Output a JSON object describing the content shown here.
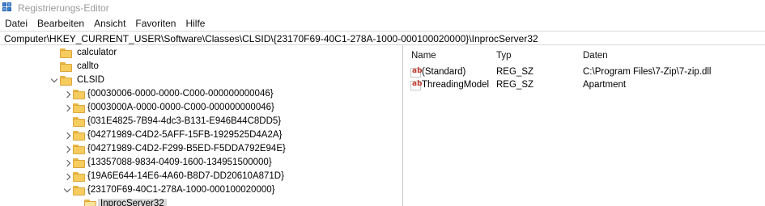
{
  "window": {
    "title": "Registrierungs-Editor",
    "app_icon": "regedit-icon"
  },
  "menu": [
    "Datei",
    "Bearbeiten",
    "Ansicht",
    "Favoriten",
    "Hilfe"
  ],
  "address": "Computer\\HKEY_CURRENT_USER\\Software\\Classes\\CLSID\\{23170F69-40C1-278A-1000-000100020000}\\InprocServer32",
  "tree": [
    {
      "label": "calculator",
      "chevron": "none",
      "open": false,
      "selected": false
    },
    {
      "label": "callto",
      "chevron": "none",
      "open": false,
      "selected": false
    },
    {
      "label": "CLSID",
      "chevron": "down",
      "open": false,
      "selected": false
    },
    {
      "label": "{00030006-0000-0000-C000-000000000046}",
      "chevron": "right",
      "open": false,
      "selected": false
    },
    {
      "label": "{0003000A-0000-0000-C000-000000000046}",
      "chevron": "right",
      "open": false,
      "selected": false
    },
    {
      "label": "{031E4825-7B94-4dc3-B131-E946B44C8DD5}",
      "chevron": "none",
      "open": false,
      "selected": false
    },
    {
      "label": "{04271989-C4D2-5AFF-15FB-1929525D4A2A}",
      "chevron": "right",
      "open": false,
      "selected": false
    },
    {
      "label": "{04271989-C4D2-F299-B5ED-F5DDA792E94E}",
      "chevron": "right",
      "open": false,
      "selected": false
    },
    {
      "label": "{13357088-9834-0409-1600-134951500000}",
      "chevron": "right",
      "open": false,
      "selected": false
    },
    {
      "label": "{19A6E644-14E6-4A60-B8D7-DD20610A871D}",
      "chevron": "right",
      "open": false,
      "selected": false
    },
    {
      "label": "{23170F69-40C1-278A-1000-000100020000}",
      "chevron": "down",
      "open": false,
      "selected": false
    },
    {
      "label": "InprocServer32",
      "chevron": "none",
      "open": true,
      "selected": true
    }
  ],
  "columns": {
    "name": "Name",
    "type": "Typ",
    "data": "Daten"
  },
  "values": [
    {
      "name": "(Standard)",
      "type": "REG_SZ",
      "data": "C:\\Program Files\\7-Zip\\7-zip.dll"
    },
    {
      "name": "ThreadingModel",
      "type": "REG_SZ",
      "data": "Apartment"
    }
  ]
}
